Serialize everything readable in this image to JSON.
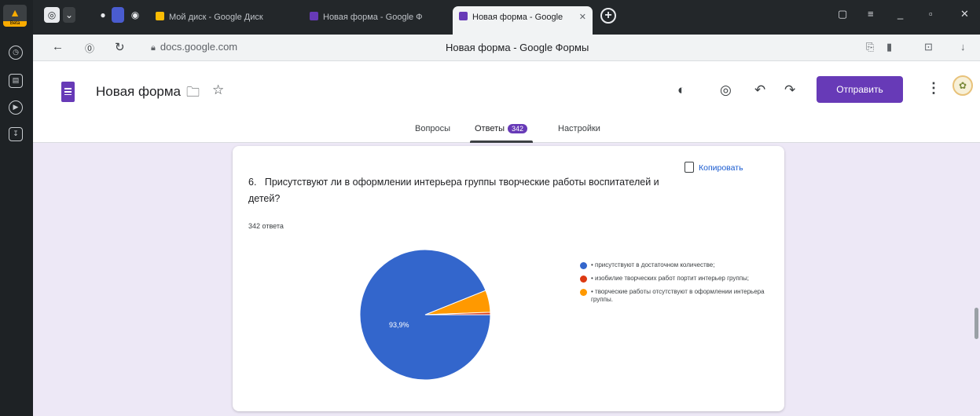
{
  "browser": {
    "logo_text": "Beta",
    "tabs": [
      {
        "label": "Мой диск - Google Диск",
        "color": "#fbbc04"
      },
      {
        "label": "Новая форма - Google Ф",
        "color": "#673ab7"
      },
      {
        "label": "Новая форма - Google",
        "color": "#673ab7"
      }
    ],
    "url": "docs.google.com",
    "page_title": "Новая форма - Google Формы"
  },
  "form": {
    "title": "Новая форма",
    "send_label": "Отправить",
    "tabs": {
      "questions": "Вопросы",
      "responses": "Ответы",
      "responses_count": "342",
      "settings": "Настройки"
    }
  },
  "question": {
    "number": "6.",
    "text": "Присутствуют ли в оформлении интерьера группы творческие работы воспитателей и детей?",
    "responses_label": "342 ответа",
    "copy_label": "Копировать"
  },
  "chart_data": {
    "type": "pie",
    "slices": [
      {
        "label": "• присутствуют в достаточном количестве;",
        "value": 93.9,
        "color": "#3366cc",
        "display": "93,9%"
      },
      {
        "label": "• изобилие творческих работ портит интерьер группы;",
        "value": 0.6,
        "color": "#dc3912",
        "display": ""
      },
      {
        "label": "• творческие работы отсутствуют в оформлении интерьера группы.",
        "value": 5.5,
        "color": "#ff9900",
        "display": ""
      }
    ]
  }
}
